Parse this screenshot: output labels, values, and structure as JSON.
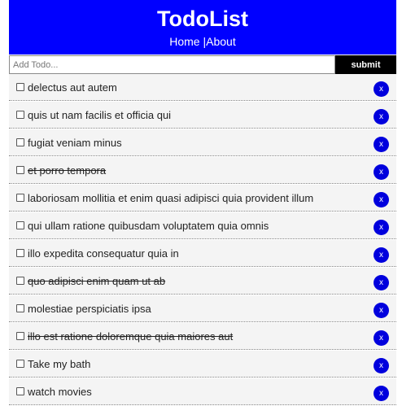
{
  "header": {
    "title": "TodoList",
    "nav_home": "Home",
    "nav_separator": " |",
    "nav_about": "About"
  },
  "add_todo": {
    "placeholder": "Add Todo...",
    "value": "",
    "submit_label": "submit"
  },
  "todos": [
    {
      "title": "delectus aut autem",
      "completed": false,
      "delete_label": "x"
    },
    {
      "title": "quis ut nam facilis et officia qui",
      "completed": false,
      "delete_label": "x"
    },
    {
      "title": "fugiat veniam minus",
      "completed": false,
      "delete_label": "x"
    },
    {
      "title": "et porro tempora",
      "completed": true,
      "delete_label": "x"
    },
    {
      "title": "laboriosam mollitia et enim quasi adipisci quia provident illum",
      "completed": false,
      "delete_label": "x"
    },
    {
      "title": "qui ullam ratione quibusdam voluptatem quia omnis",
      "completed": false,
      "delete_label": "x"
    },
    {
      "title": "illo expedita consequatur quia in",
      "completed": false,
      "delete_label": "x"
    },
    {
      "title": "quo adipisci enim quam ut ab",
      "completed": true,
      "delete_label": "x"
    },
    {
      "title": "molestiae perspiciatis ipsa",
      "completed": false,
      "delete_label": "x"
    },
    {
      "title": "illo est ratione doloremque quia maiores aut",
      "completed": true,
      "delete_label": "x"
    },
    {
      "title": "Take my bath",
      "completed": false,
      "delete_label": "x"
    },
    {
      "title": "watch movies",
      "completed": false,
      "delete_label": "x"
    }
  ],
  "colors": {
    "header_bg": "#0000ff",
    "submit_bg": "#000000",
    "delete_bg": "#0000dd",
    "item_bg": "#f4f4f4"
  }
}
